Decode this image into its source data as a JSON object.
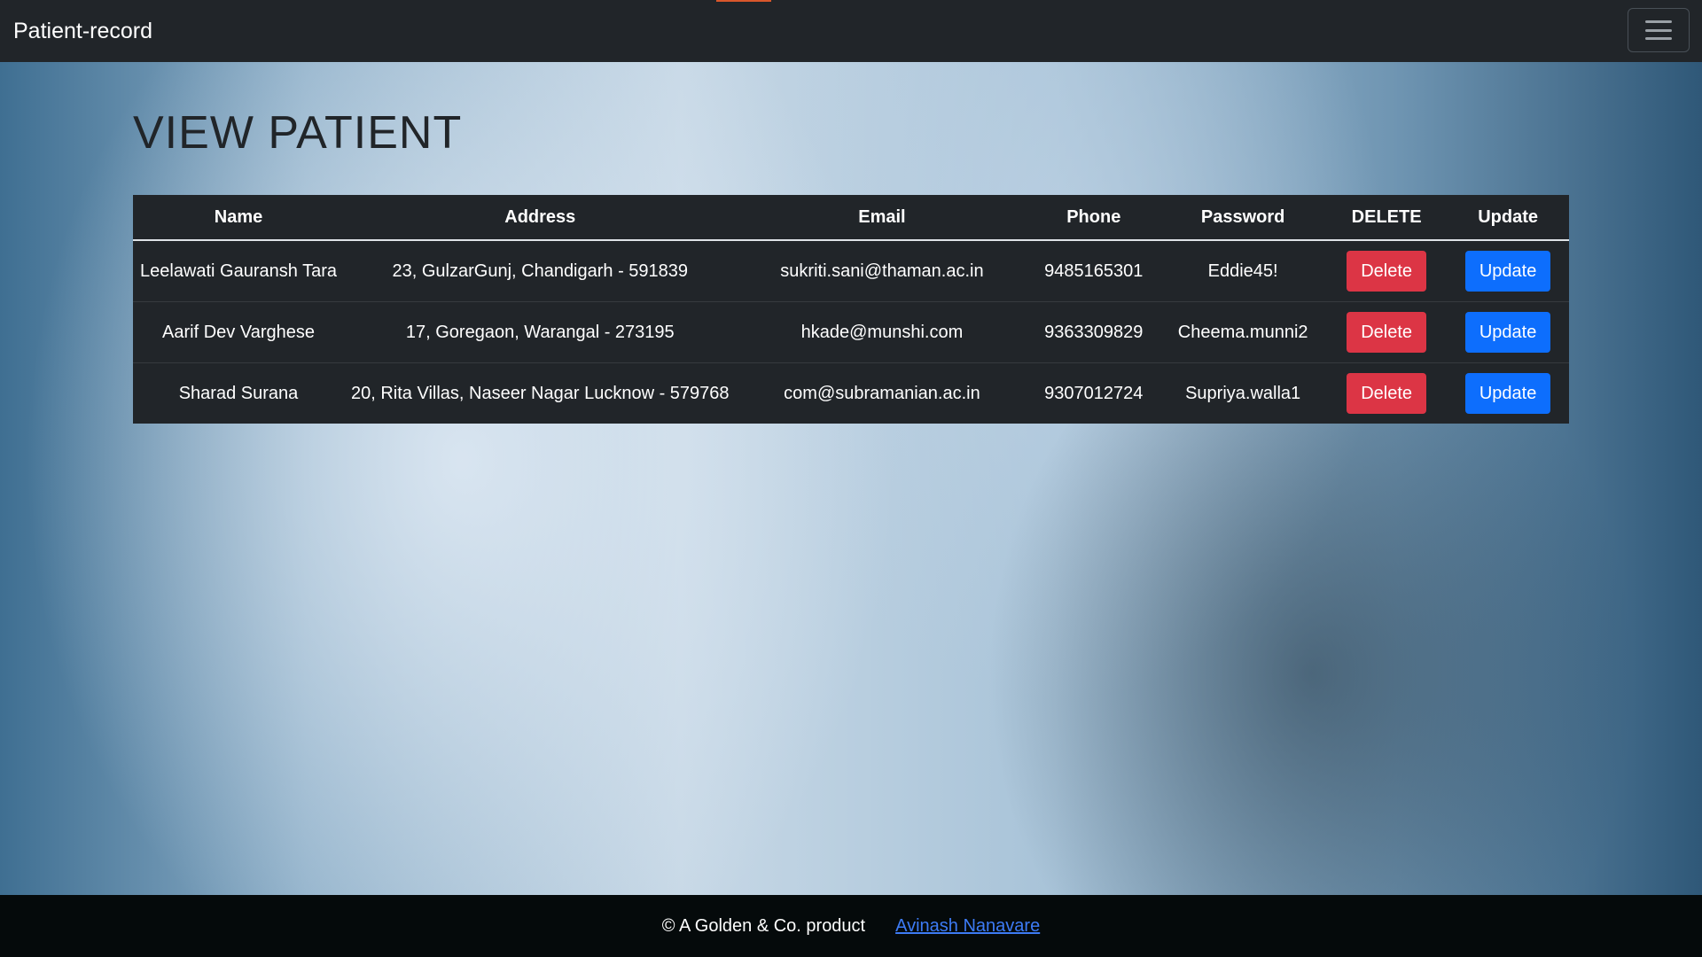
{
  "navbar": {
    "brand": "Patient-record",
    "toggler_icon": "hamburger-menu-icon"
  },
  "page": {
    "title": "VIEW PATIENT"
  },
  "table": {
    "columns": [
      "Name",
      "Address",
      "Email",
      "Phone",
      "Password",
      "DELETE",
      "Update"
    ],
    "rows": [
      {
        "name": "Leelawati Gauransh Tara",
        "address": "23, GulzarGunj, Chandigarh - 591839",
        "email": "sukriti.sani@thaman.ac.in",
        "phone": "9485165301",
        "password": "Eddie45!",
        "delete_label": "Delete",
        "update_label": "Update"
      },
      {
        "name": "Aarif Dev Varghese",
        "address": "17, Goregaon, Warangal - 273195",
        "email": "hkade@munshi.com",
        "phone": "9363309829",
        "password": "Cheema.munni2",
        "delete_label": "Delete",
        "update_label": "Update"
      },
      {
        "name": "Sharad Surana",
        "address": "20, Rita Villas, Naseer Nagar Lucknow - 579768",
        "email": "com@subramanian.ac.in",
        "phone": "9307012724",
        "password": "Supriya.walla1",
        "delete_label": "Delete",
        "update_label": "Update"
      }
    ]
  },
  "footer": {
    "text": "© A Golden & Co. product",
    "link_text": "Avinash Nanavare"
  },
  "colors": {
    "navbar_bg": "#212529",
    "delete_button": "#dc3545",
    "update_button": "#0d6efd",
    "footer_bg": "#050a0b",
    "link": "#3d7bf5"
  }
}
